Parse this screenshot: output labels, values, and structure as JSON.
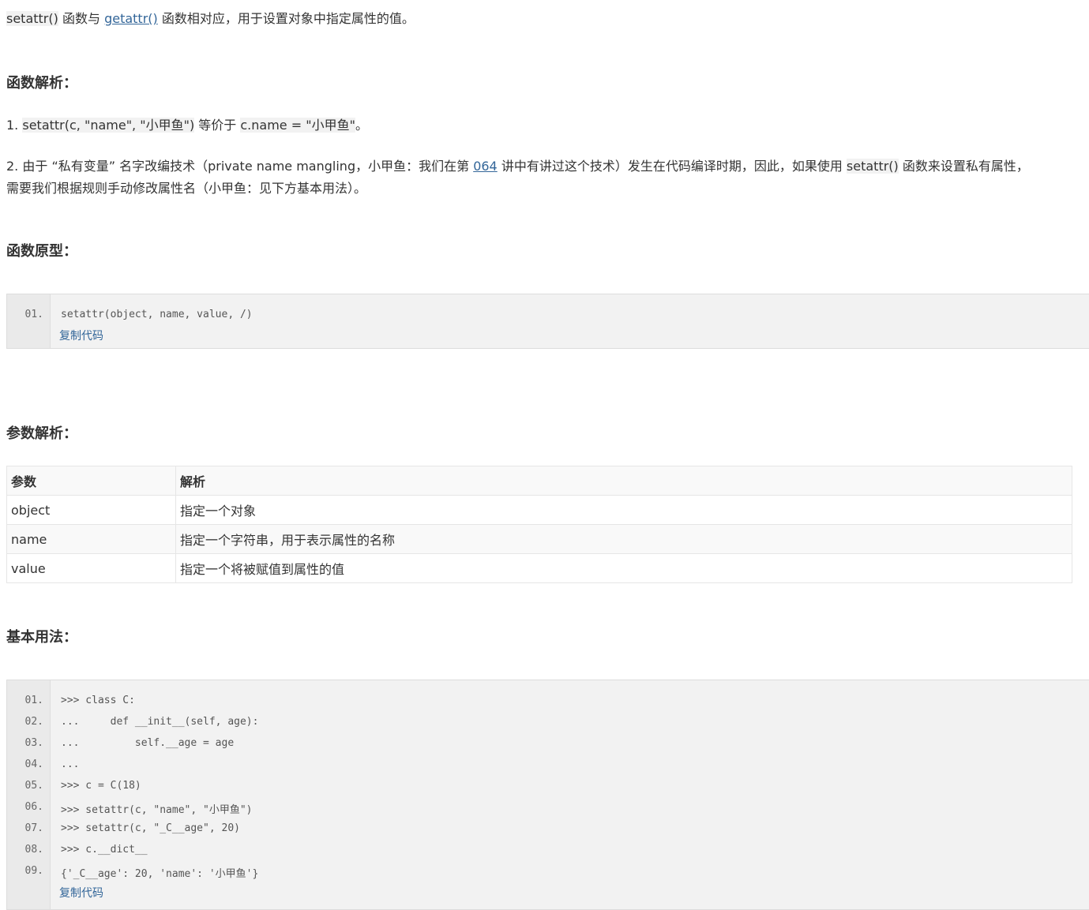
{
  "intro": {
    "code1": "setattr()",
    "text1": " 函数与 ",
    "link": "getattr()",
    "text2": " 函数相对应，用于设置对象中指定属性的值。"
  },
  "analysis": {
    "heading": "函数解析：",
    "p1_prefix": "1. ",
    "p1_code1": "setattr(c, \"name\", \"小甲鱼\")",
    "p1_mid": " 等价于 ",
    "p1_code2": "c.name = \"小甲鱼\"",
    "p1_end": "。",
    "p2_a": "2. 由于 “私有变量” 名字改编技术（private name mangling，小甲鱼：我们在第 ",
    "p2_link": "064",
    "p2_b": " 讲中有讲过这个技术）发生在代码编译时期，因此，如果使用 ",
    "p2_code": "setattr()",
    "p2_c": " 函数来设置私有属性，",
    "p2_line2": "需要我们根据规则手动修改属性名（小甲鱼：见下方基本用法）。"
  },
  "prototype": {
    "heading": "函数原型：",
    "lines": [
      {
        "num": "01.",
        "code": "setattr(object, name, value, /)"
      }
    ],
    "copy_label": "复制代码"
  },
  "params": {
    "heading": "参数解析：",
    "headers": [
      "参数",
      "解析"
    ],
    "rows": [
      [
        "object",
        "指定一个对象"
      ],
      [
        "name",
        "指定一个字符串，用于表示属性的名称"
      ],
      [
        "value",
        "指定一个将被赋值到属性的值"
      ]
    ]
  },
  "usage": {
    "heading": "基本用法：",
    "lines": [
      {
        "num": "01.",
        "code": ">>> class C:"
      },
      {
        "num": "02.",
        "code": "...     def __init__(self, age):"
      },
      {
        "num": "03.",
        "code": "...         self.__age = age"
      },
      {
        "num": "04.",
        "code": "..."
      },
      {
        "num": "05.",
        "code": ">>> c = C(18)"
      },
      {
        "num": "06.",
        "code": ">>> setattr(c, \"name\", \"小甲鱼\")"
      },
      {
        "num": "07.",
        "code": ">>> setattr(c, \"_C__age\", 20)"
      },
      {
        "num": "08.",
        "code": ">>> c.__dict__"
      },
      {
        "num": "09.",
        "code": "{'_C__age': 20, 'name': '小甲鱼'}"
      }
    ],
    "copy_label": "复制代码"
  }
}
